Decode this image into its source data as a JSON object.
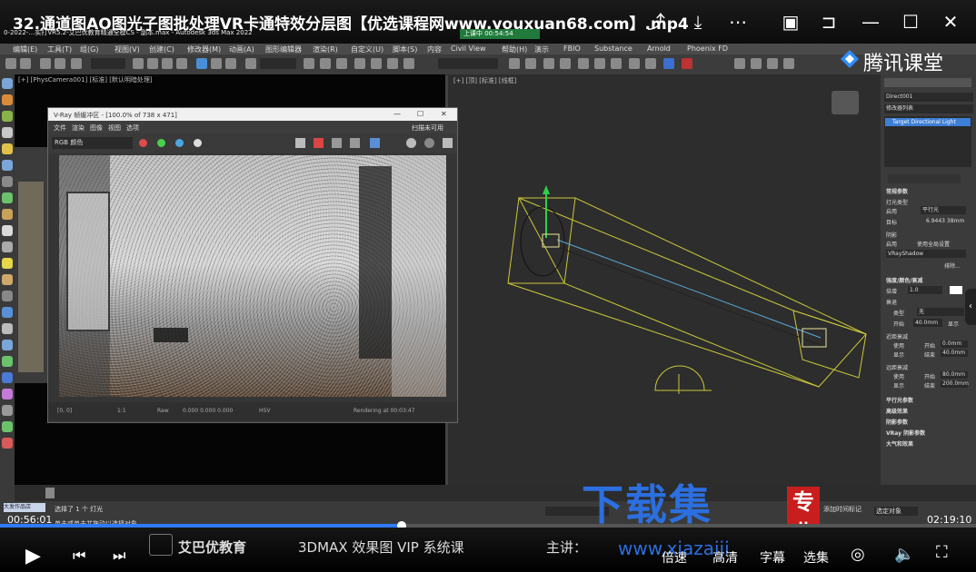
{
  "player": {
    "title": "32.通道图AO图光子图批处理VR卡通特效分层图【优选课程网www.youxuan68.com】.mp4",
    "time_elapsed": "00:56:01",
    "time_total": "02:19:10",
    "progress": 0.412,
    "controls": {
      "speed": "倍速",
      "quality": "高清",
      "subtitle": "字幕",
      "playlist": "选集"
    },
    "brand_left": "艾巴优教育",
    "brand_mid": "3DMAX 效果图 VIP 系统课",
    "brand_right": "主讲：",
    "tencent_label": "腾讯课堂"
  },
  "watermark": {
    "cn": "下载集",
    "url": "www.xiazaiji",
    "badge": "专业"
  },
  "max": {
    "window_title": "0-2022-…实打VR5.2-艾巴优教育精通全模CS - 副本.max - Autodesk 3ds Max 2022",
    "recording": "上课中 00:54:54",
    "menu": [
      "编辑(E)",
      "工具(T)",
      "组(G)",
      "视图(V)",
      "创建(C)",
      "修改器(M)",
      "动画(A)",
      "图形编辑器",
      "渲染(R)",
      "自定义(U)",
      "脚本(S)",
      "内容",
      "Civil View",
      "帮助(H)",
      "演示",
      "FBIO",
      "Substance",
      "Arnold",
      "Phoenix FD"
    ],
    "viewport_left_label": "[+] [PhysCamera001] [标准] [默认明暗处理]",
    "viewport_right_label": "[+] [顶] [标准] [线框]",
    "vfb": {
      "title": "V-Ray 帧缓冲区 - [100.0% of 738 x 471]",
      "menu": [
        "文件",
        "渲染",
        "图像",
        "视图",
        "选项"
      ],
      "layer_select": "RGB 颜色",
      "right_label": "扫描未可用",
      "status_coords": "[0, 0]",
      "status_zoom": "1:1",
      "status_mode": "Raw",
      "status_vals": "0.000  0.000  0.000",
      "status_space": "HSV",
      "status_render": "Rendering at 00:03:47"
    },
    "cmd": {
      "object_name": "Direct001",
      "modifier_list": "修改器列表",
      "stack_item": "Target Directional Light",
      "section_general": "常规参数",
      "light_type": "灯光类型",
      "enabled": "启用",
      "type_value": "平行光",
      "targeted": "目标",
      "target_dist": "6.9443 38mm",
      "shadows": "阴影",
      "shadow_enabled": "启用",
      "use_global": "使用全局设置",
      "shadow_type": "VRayShadow",
      "exclude": "排除...",
      "section_intensity": "强度/颜色/衰减",
      "multiplier_label": "倍增",
      "multiplier": "1.0",
      "decay": "衰退",
      "decay_type": "类型",
      "decay_none": "无",
      "start": "开始",
      "start_val": "40.0mm",
      "show": "显示",
      "near_atten": "近距衰减",
      "far_atten": "远距衰减",
      "use": "使用",
      "show2": "显示",
      "start_label": "开始",
      "end_label": "结束",
      "near_start": "0.0mm",
      "near_end": "40.0mm",
      "far_start": "80.0mm",
      "far_end": "200.0mm",
      "rollouts": [
        "平行光参数",
        "高级效果",
        "阴影参数",
        "VRay 阴影参数",
        "大气和效果"
      ]
    },
    "status_selected": "选择了 1 个 灯光",
    "status_hint": "单击或单击并拖动以选择对象",
    "status_script": "大发作品店",
    "status_right": "添加时间标记",
    "status_filter": "选定对象"
  }
}
